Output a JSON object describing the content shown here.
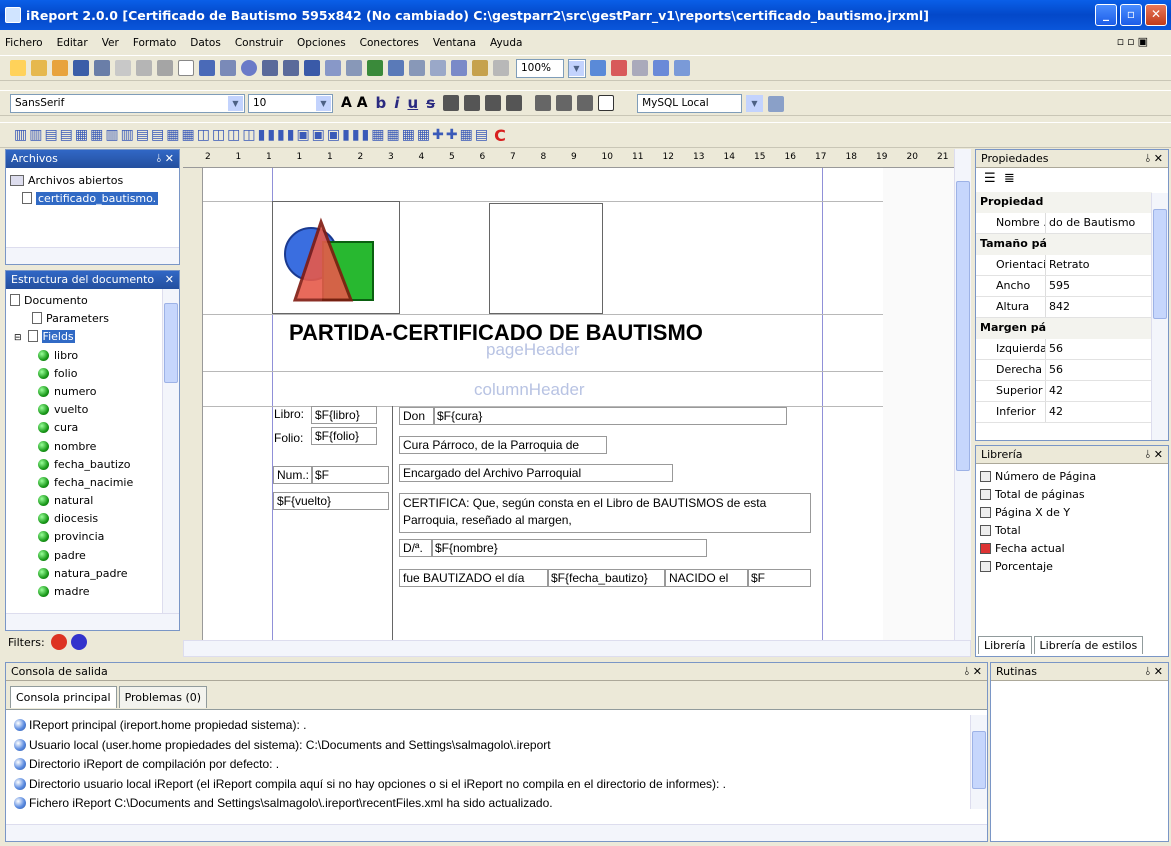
{
  "window": {
    "title": "iReport 2.0.0  [Certificado de Bautismo 595x842 (No cambiado) C:\\gestparr2\\src\\gestParr_v1\\reports\\certificado_bautismo.jrxml]"
  },
  "menu": [
    "Fichero",
    "Editar",
    "Ver",
    "Formato",
    "Datos",
    "Construir",
    "Opciones",
    "Conectores",
    "Ventana",
    "Ayuda"
  ],
  "toolbar": {
    "zoom": "100%",
    "font": "SansSerif",
    "size": "10",
    "connection": "MySQL Local"
  },
  "archivos": {
    "title": "Archivos",
    "root": "Archivos abiertos",
    "file": "certificado_bautismo."
  },
  "estructura": {
    "title": "Estructura del documento",
    "items": [
      "Documento",
      "Parameters",
      "Fields"
    ],
    "fields": [
      "libro",
      "folio",
      "numero",
      "vuelto",
      "cura",
      "nombre",
      "fecha_bautizo",
      "fecha_nacimie",
      "natural",
      "diocesis",
      "provincia",
      "padre",
      "natura_padre",
      "madre"
    ],
    "filters": "Filters:"
  },
  "report": {
    "title": "PARTIDA-CERTIFICADO DE BAUTISMO",
    "band_page": "pageHeader",
    "band_col": "columnHeader",
    "ruler": [
      "2",
      "1",
      "1",
      "1",
      "1",
      "2",
      "3",
      "4",
      "5",
      "6",
      "7",
      "8",
      "9",
      "10",
      "11",
      "12",
      "13",
      "14",
      "15",
      "16",
      "17",
      "18",
      "19",
      "20",
      "21"
    ],
    "left_fields": [
      {
        "label": "Libro:",
        "val": "$F{libro}"
      },
      {
        "label": "Folio:",
        "val": "$F{folio}"
      },
      {
        "label": "Num.:",
        "val": "$F"
      },
      {
        "label": "",
        "val": "$F{vuelto}"
      }
    ],
    "right_fields": [
      "Don",
      "$F{cura}",
      "Cura Párroco, de la Parroquia de",
      "Encargado del Archivo Parroquial",
      "CERTIFICA: Que, según consta en el Libro de BAUTISMOS de esta Parroquia, reseñado al margen,",
      "D/ª.",
      "$F{nombre}",
      "fue BAUTIZADO el día",
      "$F{fecha_bautizo}",
      "NACIDO el",
      "$F"
    ]
  },
  "propiedades": {
    "title": "Propiedades",
    "cat1": "Propiedad",
    "nombre_k": "Nombre ...",
    "nombre_v": "do de Bautismo",
    "cat2": "Tamaño pá",
    "orient_k": "Orientación",
    "orient_v": "Retrato",
    "ancho_k": "Ancho",
    "ancho_v": "595",
    "altura_k": "Altura",
    "altura_v": "842",
    "cat3": "Margen pá",
    "izq_k": "Izquierda",
    "izq_v": "56",
    "der_k": "Derecha",
    "der_v": "56",
    "sup_k": "Superior",
    "sup_v": "42",
    "inf_k": "Inferior",
    "inf_v": "42"
  },
  "libreria": {
    "title": "Librería",
    "items": [
      "Número de Página",
      "Total de páginas",
      "Página X de Y",
      "Total",
      "Fecha actual",
      "Porcentaje"
    ],
    "tabs": [
      "Librería",
      "Librería de estilos"
    ]
  },
  "consola": {
    "title": "Consola de salida",
    "tabs": [
      "Consola principal",
      "Problemas (0)"
    ],
    "lines": [
      "IReport principal (ireport.home propiedad sistema): .",
      "Usuario local (user.home propiedades del sistema): C:\\Documents and Settings\\salmagolo\\.ireport",
      "Directorio iReport de compilación por defecto: .",
      "Directorio usuario local iReport (el iReport compila aquí si no hay opciones o si el iReport no compila en el directorio de informes): .",
      "Fichero iReport C:\\Documents and Settings\\salmagolo\\.ireport\\recentFiles.xml ha sido actualizado."
    ]
  },
  "rutinas": {
    "title": "Rutinas"
  }
}
